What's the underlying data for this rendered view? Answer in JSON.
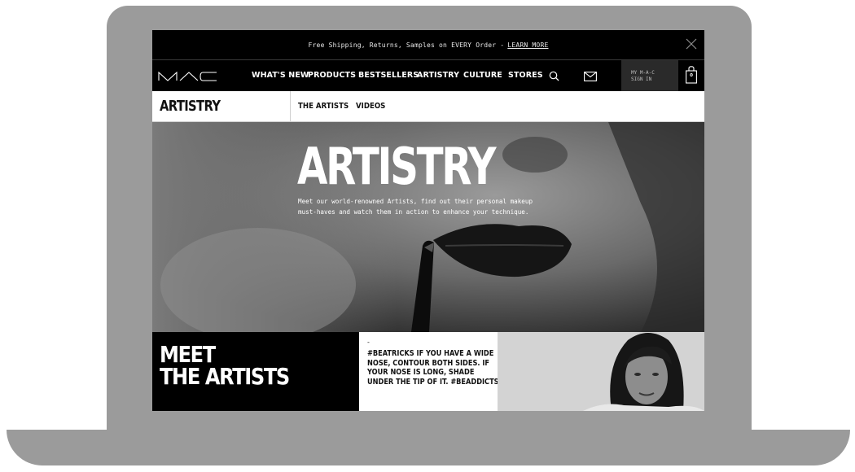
{
  "promo": {
    "text": "Free Shipping, Returns, Samples on EVERY Order -",
    "link": "LEARN MORE"
  },
  "nav": {
    "items": [
      "WHAT'S NEW",
      "PRODUCTS",
      "BESTSELLERS",
      "ARTISTRY",
      "CULTURE",
      "STORES"
    ],
    "account_line1": "MY M-A-C",
    "account_line2": "SIGN IN",
    "bag_count": "0"
  },
  "subnav": {
    "title": "ARTISTRY",
    "items": [
      "THE ARTISTS",
      "VIDEOS"
    ]
  },
  "hero": {
    "title": "ARTISTRY",
    "description": "Meet our world-renowned Artists, find out their personal makeup must-haves and watch them in action to enhance your technique."
  },
  "tiles": {
    "meet_line1": "MEET",
    "meet_line2": "THE ARTISTS",
    "tip_dash": "-",
    "tip_text": "#BEATRICKS IF YOU HAVE A WIDE NOSE, CONTOUR BOTH SIDES. IF YOUR NOSE IS LONG, SHADE UNDER THE TIP OF IT. #BEADDICTS"
  },
  "icons": [
    "close-icon",
    "mac-logo",
    "search-icon",
    "mail-icon",
    "shopping-bag-icon"
  ],
  "colors": {
    "frame": "#9b9b9b",
    "bar": "#000000",
    "text_light": "#ffffff"
  }
}
